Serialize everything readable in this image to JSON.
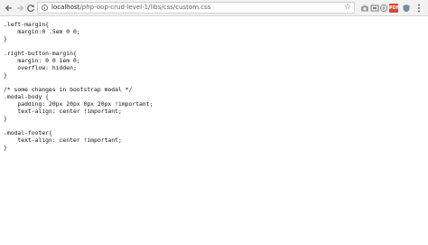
{
  "browser": {
    "url_prefix": "",
    "url_host": "localhost",
    "url_path": "/php-oop-crud-level-1/libs/css/custom.css",
    "icons": {
      "back": "back-arrow-icon",
      "forward": "forward-arrow-icon",
      "reload": "reload-icon",
      "star": "star-icon",
      "page": "page-info-icon",
      "menu": "kebab-menu-icon"
    }
  },
  "file_lines": [
    ".left-margin{",
    "    margin:0 .5em 0 0;",
    "}",
    "",
    ".right-button-margin{",
    "    margin: 0 0 1em 0;",
    "    overflow: hidden;",
    "}",
    "",
    "/* some changes in bootstrap modal */",
    ".modal-body {",
    "    padding: 20px 20px 0px 20px !important;",
    "    text-align: center !important;",
    "}",
    "",
    ".modal-footer{",
    "    text-align: center !important;",
    "}"
  ]
}
